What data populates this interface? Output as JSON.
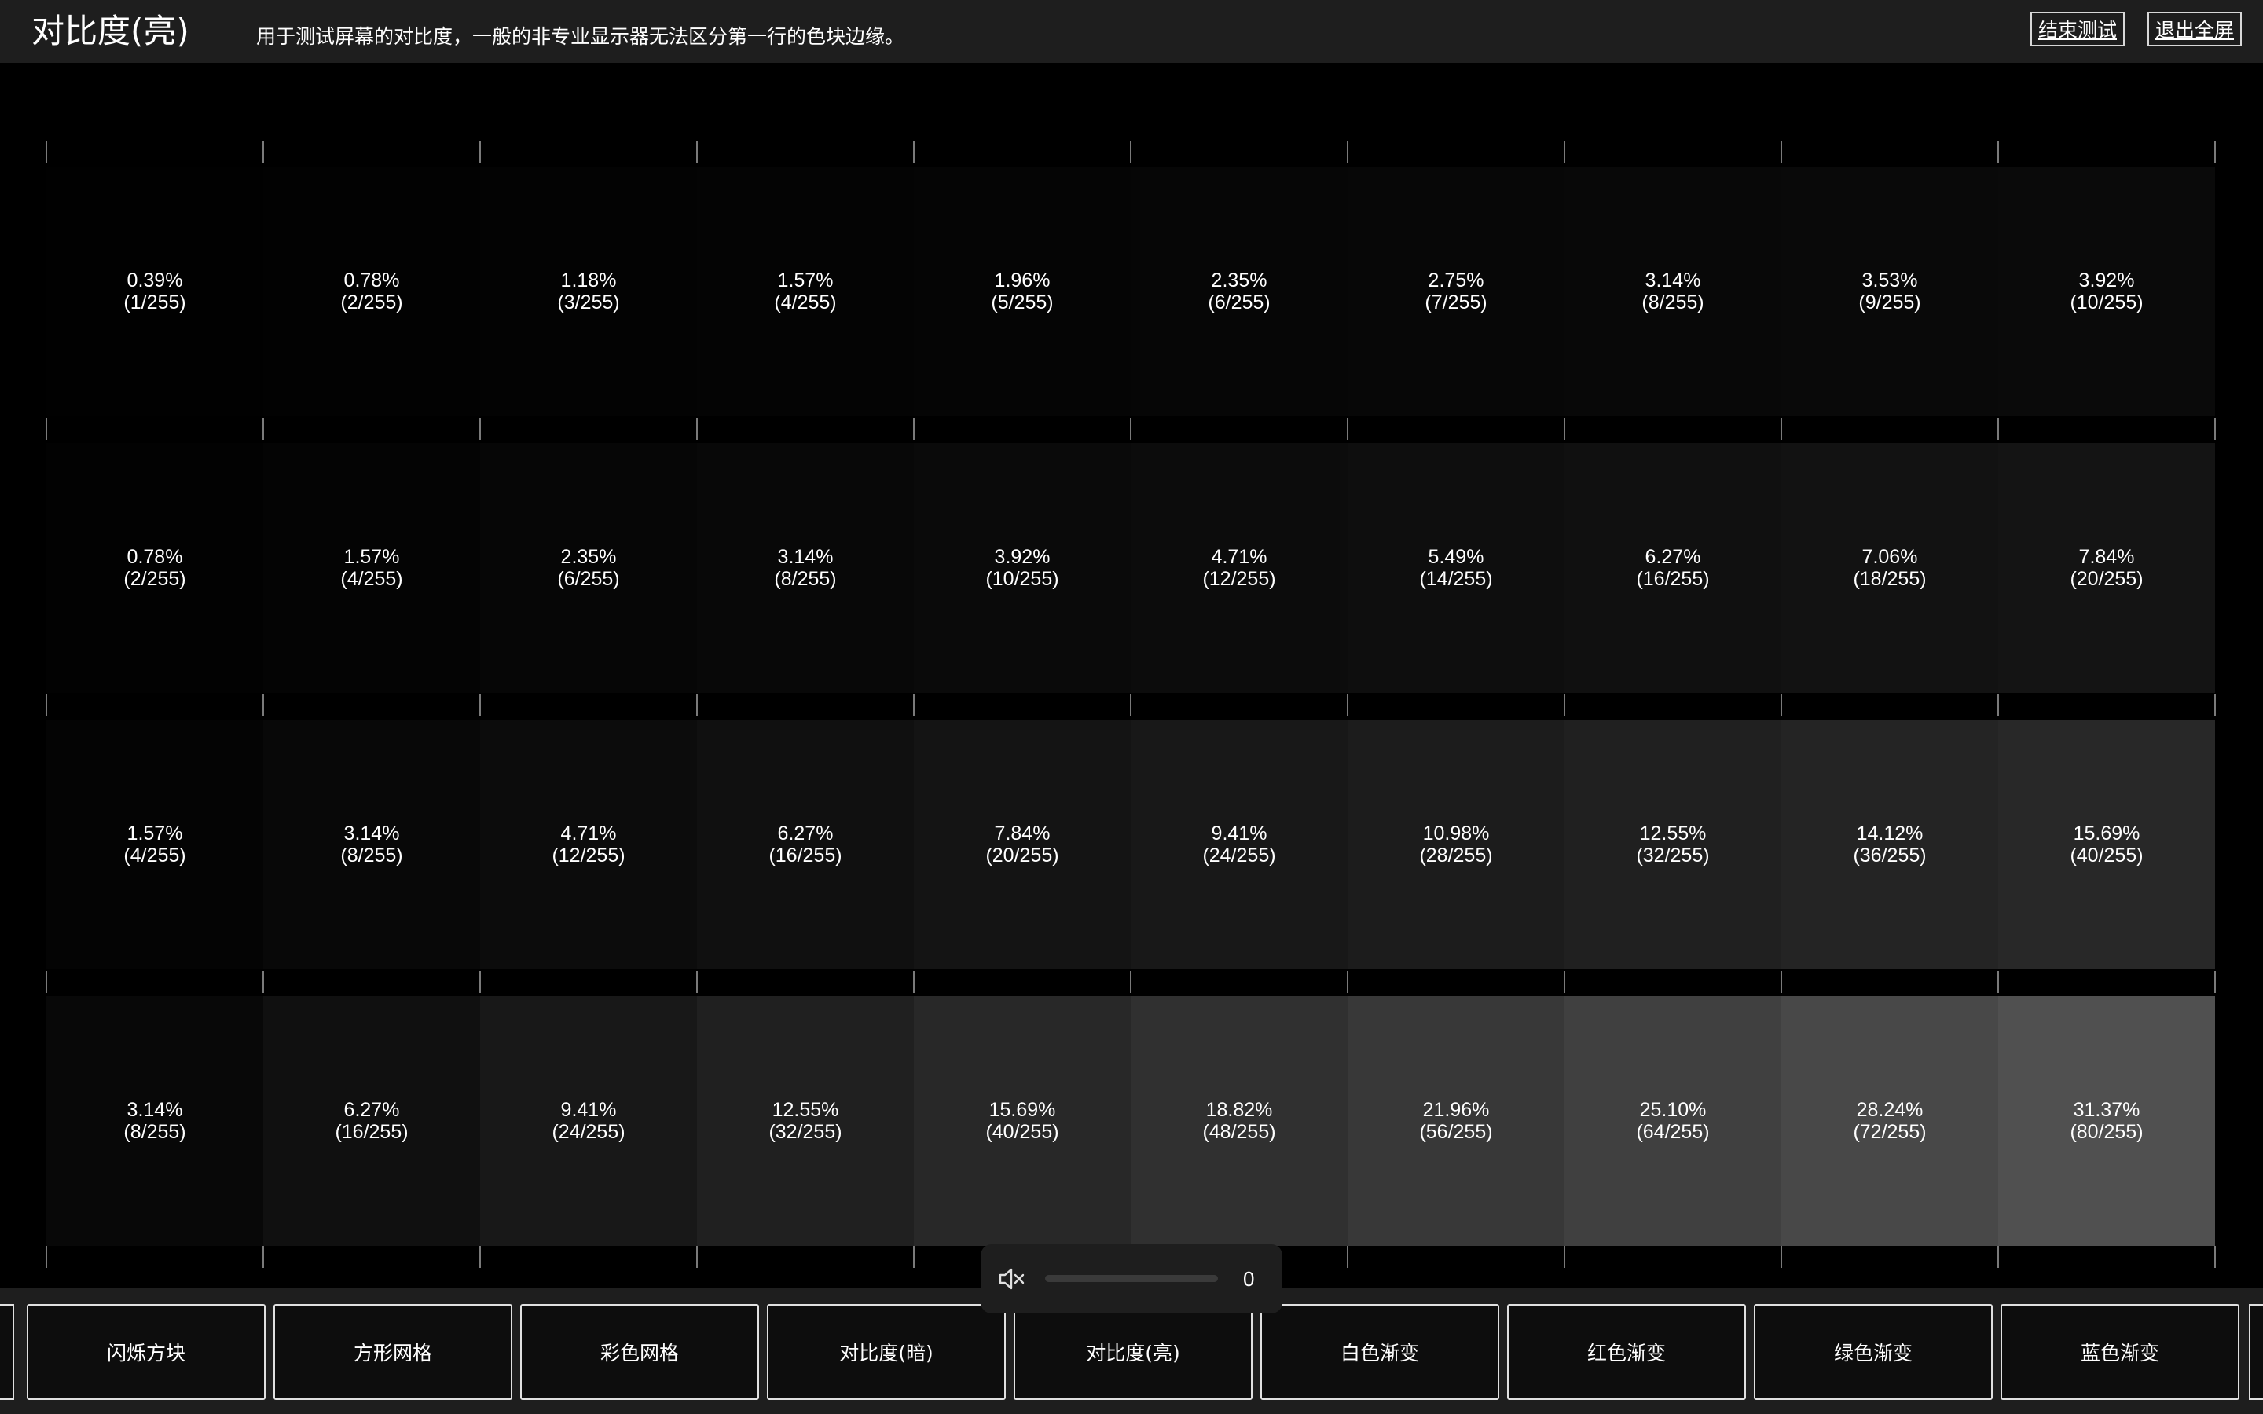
{
  "header": {
    "title": "对比度(亮)",
    "description": "用于测试屏幕的对比度，一般的非专业显示器无法区分第一行的色块边缘。",
    "end_test_label": "结束测试",
    "exit_fullscreen_label": "退出全屏"
  },
  "grid": {
    "rows": [
      {
        "cells": [
          {
            "percent": "0.39%",
            "fraction": "(1/255)",
            "level": 1
          },
          {
            "percent": "0.78%",
            "fraction": "(2/255)",
            "level": 2
          },
          {
            "percent": "1.18%",
            "fraction": "(3/255)",
            "level": 3
          },
          {
            "percent": "1.57%",
            "fraction": "(4/255)",
            "level": 4
          },
          {
            "percent": "1.96%",
            "fraction": "(5/255)",
            "level": 5
          },
          {
            "percent": "2.35%",
            "fraction": "(6/255)",
            "level": 6
          },
          {
            "percent": "2.75%",
            "fraction": "(7/255)",
            "level": 7
          },
          {
            "percent": "3.14%",
            "fraction": "(8/255)",
            "level": 8
          },
          {
            "percent": "3.53%",
            "fraction": "(9/255)",
            "level": 9
          },
          {
            "percent": "3.92%",
            "fraction": "(10/255)",
            "level": 10
          }
        ]
      },
      {
        "cells": [
          {
            "percent": "0.78%",
            "fraction": "(2/255)",
            "level": 2
          },
          {
            "percent": "1.57%",
            "fraction": "(4/255)",
            "level": 4
          },
          {
            "percent": "2.35%",
            "fraction": "(6/255)",
            "level": 6
          },
          {
            "percent": "3.14%",
            "fraction": "(8/255)",
            "level": 8
          },
          {
            "percent": "3.92%",
            "fraction": "(10/255)",
            "level": 10
          },
          {
            "percent": "4.71%",
            "fraction": "(12/255)",
            "level": 12
          },
          {
            "percent": "5.49%",
            "fraction": "(14/255)",
            "level": 14
          },
          {
            "percent": "6.27%",
            "fraction": "(16/255)",
            "level": 16
          },
          {
            "percent": "7.06%",
            "fraction": "(18/255)",
            "level": 18
          },
          {
            "percent": "7.84%",
            "fraction": "(20/255)",
            "level": 20
          }
        ]
      },
      {
        "cells": [
          {
            "percent": "1.57%",
            "fraction": "(4/255)",
            "level": 4
          },
          {
            "percent": "3.14%",
            "fraction": "(8/255)",
            "level": 8
          },
          {
            "percent": "4.71%",
            "fraction": "(12/255)",
            "level": 12
          },
          {
            "percent": "6.27%",
            "fraction": "(16/255)",
            "level": 16
          },
          {
            "percent": "7.84%",
            "fraction": "(20/255)",
            "level": 20
          },
          {
            "percent": "9.41%",
            "fraction": "(24/255)",
            "level": 24
          },
          {
            "percent": "10.98%",
            "fraction": "(28/255)",
            "level": 28
          },
          {
            "percent": "12.55%",
            "fraction": "(32/255)",
            "level": 32
          },
          {
            "percent": "14.12%",
            "fraction": "(36/255)",
            "level": 36
          },
          {
            "percent": "15.69%",
            "fraction": "(40/255)",
            "level": 40
          }
        ]
      },
      {
        "cells": [
          {
            "percent": "3.14%",
            "fraction": "(8/255)",
            "level": 8
          },
          {
            "percent": "6.27%",
            "fraction": "(16/255)",
            "level": 16
          },
          {
            "percent": "9.41%",
            "fraction": "(24/255)",
            "level": 24
          },
          {
            "percent": "12.55%",
            "fraction": "(32/255)",
            "level": 32
          },
          {
            "percent": "15.69%",
            "fraction": "(40/255)",
            "level": 40
          },
          {
            "percent": "18.82%",
            "fraction": "(48/255)",
            "level": 48
          },
          {
            "percent": "21.96%",
            "fraction": "(56/255)",
            "level": 56
          },
          {
            "percent": "25.10%",
            "fraction": "(64/255)",
            "level": 64
          },
          {
            "percent": "28.24%",
            "fraction": "(72/255)",
            "level": 72
          },
          {
            "percent": "31.37%",
            "fraction": "(80/255)",
            "level": 80
          }
        ]
      }
    ]
  },
  "volume": {
    "icon": "speaker-muted-icon",
    "value": "0",
    "level_fraction": 0
  },
  "bottom_tabs": [
    {
      "label": "闪烁方块"
    },
    {
      "label": "方形网格"
    },
    {
      "label": "彩色网格"
    },
    {
      "label": "对比度(暗)"
    },
    {
      "label": "对比度(亮)"
    },
    {
      "label": "白色渐变"
    },
    {
      "label": "红色渐变"
    },
    {
      "label": "绿色渐变"
    },
    {
      "label": "蓝色渐变"
    }
  ],
  "colors": {
    "header_bg": "#1e1e1e",
    "page_bg": "#000000",
    "tab_bg": "#0d0d0d",
    "tab_border": "#e0e0e0",
    "text": "#ffffff"
  }
}
